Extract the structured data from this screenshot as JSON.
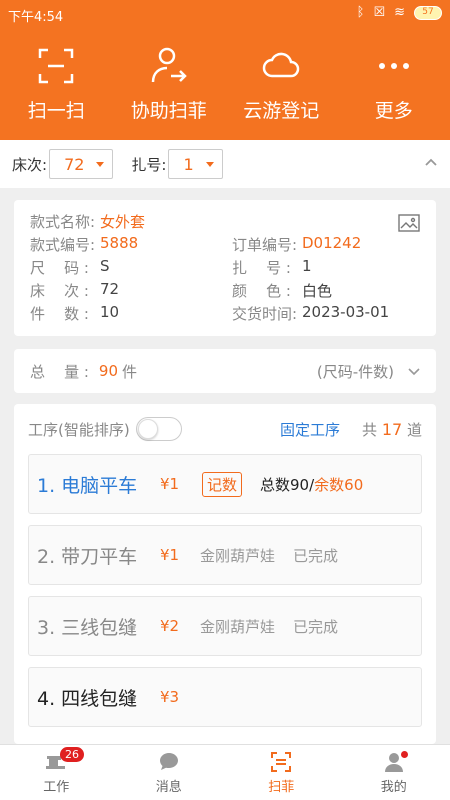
{
  "status_bar": {
    "time": "下午4:54",
    "battery": "57"
  },
  "top_nav": [
    {
      "label": "扫一扫",
      "icon": "scan-frame-icon"
    },
    {
      "label": "协助扫菲",
      "icon": "user-forward-icon"
    },
    {
      "label": "云游登记",
      "icon": "cloud-icon"
    },
    {
      "label": "更多",
      "icon": "more-dots-icon"
    }
  ],
  "filter": {
    "bed_label": "床次:",
    "bed_value": "72",
    "bundle_label": "扎号:",
    "bundle_value": "1"
  },
  "info": {
    "rows": [
      [
        {
          "k": "款式名称:",
          "v": "女外套",
          "orange": true
        },
        null
      ],
      [
        {
          "k": "款式编号:",
          "v": "5888",
          "orange": true
        },
        {
          "k": "订单编号:",
          "v": "D01242",
          "orange": true
        }
      ],
      [
        {
          "k": "尺    码 :",
          "v": "S"
        },
        {
          "k": "扎    号 :",
          "v": "1"
        }
      ],
      [
        {
          "k": "床    次 :",
          "v": "72"
        },
        {
          "k": "颜    色 :",
          "v": "白色"
        }
      ],
      [
        {
          "k": "件    数 :",
          "v": "10"
        },
        {
          "k": "交货时间:",
          "v": "2023-03-01"
        }
      ]
    ]
  },
  "total": {
    "label": "总    量 :",
    "value": "90",
    "unit": "件",
    "mode": "(尺码-件数)"
  },
  "process": {
    "toggle_label": "工序(智能排序)",
    "fixed_label": "固定工序",
    "count_prefix": "共",
    "count": "17",
    "count_suffix": "道",
    "items": [
      {
        "name": "1. 电脑平车",
        "price": "¥1",
        "tag": "记数",
        "total": "总数90/",
        "remaining": "余数60",
        "state": "active"
      },
      {
        "name": "2. 带刀平车",
        "price": "¥1",
        "worker": "金刚葫芦娃",
        "status": "已完成",
        "state": "done"
      },
      {
        "name": "3. 三线包缝",
        "price": "¥2",
        "worker": "金刚葫芦娃",
        "status": "已完成",
        "state": "done"
      },
      {
        "name": "4. 四线包缝",
        "price": "¥3",
        "state": "todo"
      }
    ]
  },
  "bottom_nav": [
    {
      "label": "工作",
      "badge": "26"
    },
    {
      "label": "消息"
    },
    {
      "label": "扫菲",
      "active": true
    },
    {
      "label": "我的",
      "dot": true
    }
  ]
}
